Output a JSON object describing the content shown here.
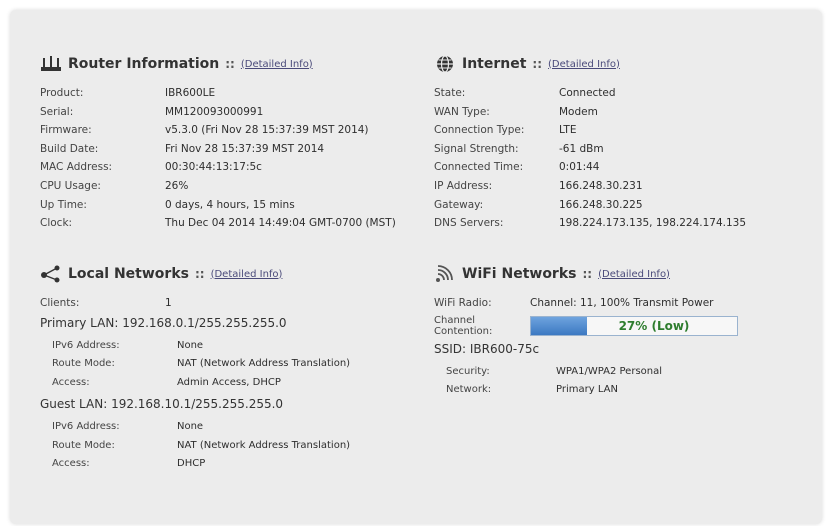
{
  "router": {
    "title": "Router Information",
    "sep": "::",
    "link": "(Detailed Info)",
    "rows": [
      {
        "k": "Product:",
        "v": "IBR600LE"
      },
      {
        "k": "Serial:",
        "v": "MM120093000991"
      },
      {
        "k": "Firmware:",
        "v": "v5.3.0 (Fri Nov 28 15:37:39 MST 2014)"
      },
      {
        "k": "Build Date:",
        "v": "Fri Nov 28 15:37:39 MST 2014"
      },
      {
        "k": "MAC Address:",
        "v": "00:30:44:13:17:5c"
      },
      {
        "k": "CPU Usage:",
        "v": "26%"
      },
      {
        "k": "Up Time:",
        "v": "0 days, 4 hours, 15 mins"
      },
      {
        "k": "Clock:",
        "v": "Thu Dec 04 2014 14:49:04 GMT-0700 (MST)"
      }
    ]
  },
  "internet": {
    "title": "Internet",
    "sep": "::",
    "link": "(Detailed Info)",
    "rows": [
      {
        "k": "State:",
        "v": "Connected"
      },
      {
        "k": "WAN Type:",
        "v": "Modem"
      },
      {
        "k": "Connection Type:",
        "v": "LTE"
      },
      {
        "k": "Signal Strength:",
        "v": "-61 dBm"
      },
      {
        "k": "Connected Time:",
        "v": "0:01:44"
      },
      {
        "k": "IP Address:",
        "v": "166.248.30.231"
      },
      {
        "k": "Gateway:",
        "v": "166.248.30.225"
      },
      {
        "k": "DNS Servers:",
        "v": "198.224.173.135, 198.224.174.135"
      }
    ]
  },
  "local": {
    "title": "Local Networks",
    "sep": "::",
    "link": "(Detailed Info)",
    "clients_label": "Clients:",
    "clients_value": "1",
    "primary_lan": "Primary LAN: 192.168.0.1/255.255.255.0",
    "primary_rows": [
      {
        "k": "IPv6 Address:",
        "v": "None"
      },
      {
        "k": "Route Mode:",
        "v": "NAT (Network Address Translation)"
      },
      {
        "k": "Access:",
        "v": "Admin Access, DHCP"
      }
    ],
    "guest_lan": "Guest LAN: 192.168.10.1/255.255.255.0",
    "guest_rows": [
      {
        "k": "IPv6 Address:",
        "v": "None"
      },
      {
        "k": "Route Mode:",
        "v": "NAT (Network Address Translation)"
      },
      {
        "k": "Access:",
        "v": "DHCP"
      }
    ]
  },
  "wifi": {
    "title": "WiFi Networks",
    "sep": "::",
    "link": "(Detailed Info)",
    "radio_label": "WiFi Radio:",
    "radio_value": "Channel: 11, 100% Transmit Power",
    "contention_label_1": "Channel",
    "contention_label_2": "Contention:",
    "contention_text": "27% (Low)",
    "contention_fraction": 0.27,
    "ssid": "SSID: IBR600-75c",
    "ssid_rows": [
      {
        "k": "Security:",
        "v": "WPA1/WPA2 Personal"
      },
      {
        "k": "Network:",
        "v": "Primary LAN"
      }
    ]
  },
  "icons": {
    "router": "router-icon",
    "internet": "globe-icon",
    "local": "network-nodes-icon",
    "wifi": "wifi-icon"
  },
  "colors": {
    "panel": "#ececec",
    "link": "#4a4a7a",
    "progress_fill": "#3c79c2",
    "progress_text": "#2e7d2e"
  }
}
